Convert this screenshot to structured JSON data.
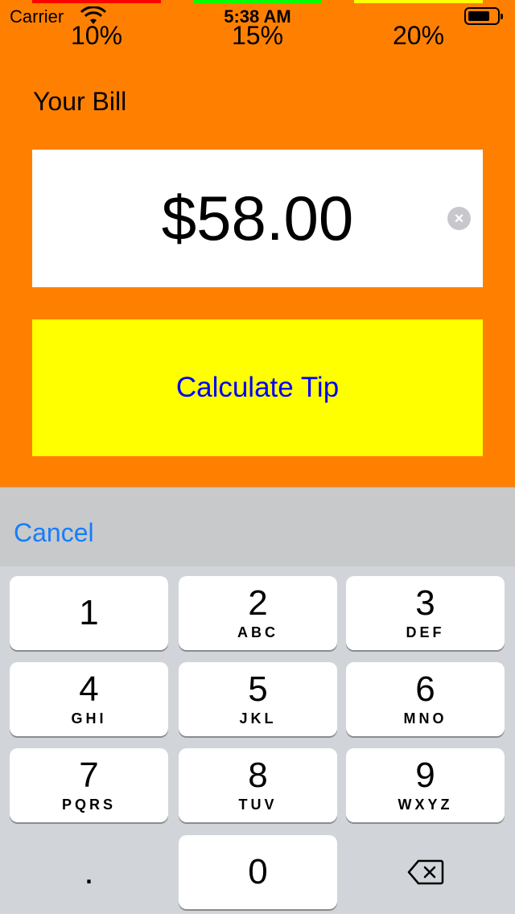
{
  "status_bar": {
    "carrier": "Carrier",
    "time": "5:38 AM"
  },
  "tip_options": [
    {
      "label": "10%",
      "color": "#FF0000"
    },
    {
      "label": "15%",
      "color": "#00FF00"
    },
    {
      "label": "20%",
      "color": "#FFFF00"
    }
  ],
  "bill": {
    "label": "Your Bill",
    "value": "$58.00"
  },
  "calculate_button": {
    "label": "Calculate Tip"
  },
  "toolbar": {
    "cancel_label": "Cancel"
  },
  "keypad": {
    "keys": [
      {
        "digit": "1",
        "letters": ""
      },
      {
        "digit": "2",
        "letters": "ABC"
      },
      {
        "digit": "3",
        "letters": "DEF"
      },
      {
        "digit": "4",
        "letters": "GHI"
      },
      {
        "digit": "5",
        "letters": "JKL"
      },
      {
        "digit": "6",
        "letters": "MNO"
      },
      {
        "digit": "7",
        "letters": "PQRS"
      },
      {
        "digit": "8",
        "letters": "TUV"
      },
      {
        "digit": "9",
        "letters": "WXYZ"
      },
      {
        "digit": "0",
        "letters": ""
      }
    ],
    "decimal": ".",
    "delete_icon": "backspace-icon"
  },
  "colors": {
    "background": "#FF8000",
    "button_bg": "#FFFF00",
    "button_text": "#0000FF",
    "accent": "#147EFB"
  }
}
